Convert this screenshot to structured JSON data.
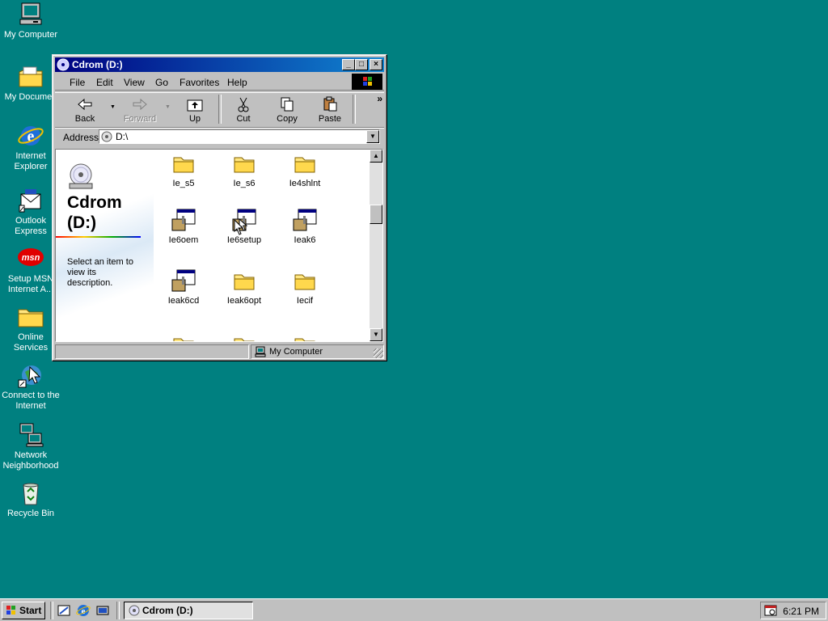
{
  "desktop": {
    "background": "#008080",
    "icons": [
      {
        "label": "My Computer",
        "icon": "my-computer-icon"
      },
      {
        "label": "My Documen",
        "icon": "my-documents-icon"
      },
      {
        "label": "Internet Explorer",
        "icon": "internet-explorer-icon"
      },
      {
        "label": "Outlook Express",
        "icon": "outlook-express-icon"
      },
      {
        "label": "Setup MSN Internet A...",
        "icon": "msn-icon"
      },
      {
        "label": "Online Services",
        "icon": "folder-icon"
      },
      {
        "label": "Connect to the Internet",
        "icon": "connect-internet-icon"
      },
      {
        "label": "Network Neighborhood",
        "icon": "network-icon"
      },
      {
        "label": "Recycle Bin",
        "icon": "recycle-bin-icon"
      }
    ]
  },
  "window": {
    "title": "Cdrom (D:)",
    "title_gradient": [
      "#000080",
      "#1084d0"
    ],
    "menu": [
      "File",
      "Edit",
      "View",
      "Go",
      "Favorites",
      "Help"
    ],
    "toolbar": {
      "back": "Back",
      "forward": "Forward",
      "up": "Up",
      "cut": "Cut",
      "copy": "Copy",
      "paste": "Paste",
      "more": "»"
    },
    "address": {
      "label": "Address",
      "value": "D:\\"
    },
    "webview": {
      "title_line1": "Cdrom",
      "title_line2": "(D:)",
      "description": "Select an item to view its description."
    },
    "files": [
      {
        "name": "Ie_s5",
        "type": "folder-icon"
      },
      {
        "name": "Ie_s6",
        "type": "folder-icon"
      },
      {
        "name": "Ie4shlnt",
        "type": "folder-icon"
      },
      {
        "name": "Ie6oem",
        "type": "setup-program-icon"
      },
      {
        "name": "Ie6setup",
        "type": "setup-program-icon"
      },
      {
        "name": "Ieak6",
        "type": "setup-program-icon"
      },
      {
        "name": "Ieak6cd",
        "type": "setup-program-icon"
      },
      {
        "name": "Ieak6opt",
        "type": "folder-icon"
      },
      {
        "name": "Iecif",
        "type": "folder-icon"
      }
    ],
    "status": {
      "location": "My Computer"
    }
  },
  "taskbar": {
    "start": "Start",
    "task_title": "Cdrom (D:)",
    "clock": "6:21 PM"
  }
}
